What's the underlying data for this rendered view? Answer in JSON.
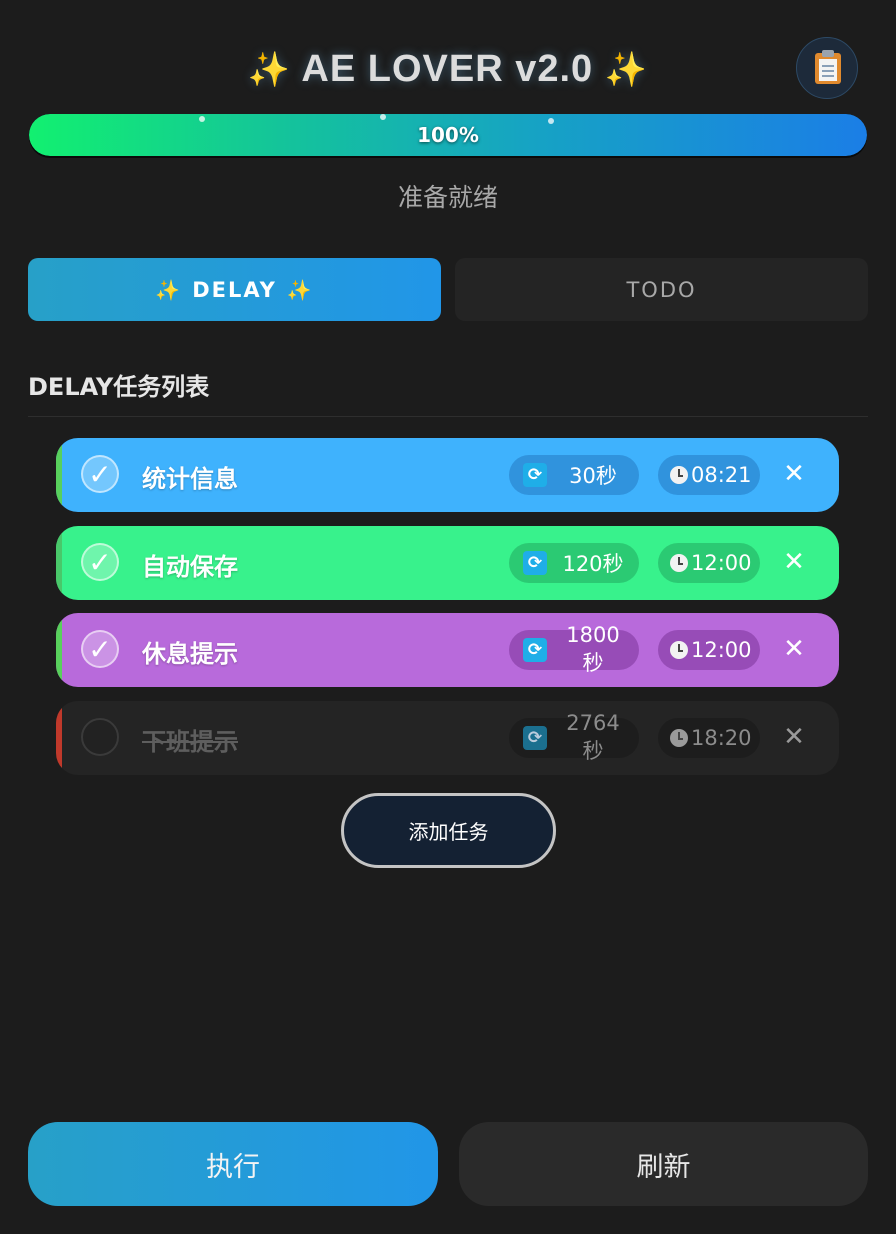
{
  "header": {
    "title": "AE LOVER v2.0",
    "sparkle": "✨",
    "clipboard_icon": "clipboard-icon"
  },
  "progress": {
    "percent": 100,
    "label": "100%",
    "status": "准备就绪"
  },
  "tabs": [
    {
      "label": "DELAY",
      "active": true
    },
    {
      "label": "TODO",
      "active": false
    }
  ],
  "section": {
    "title": "DELAY任务列表"
  },
  "tasks": [
    {
      "name": "统计信息",
      "interval": "30秒",
      "time": "08:21",
      "enabled": true,
      "color": "#3fb2fd"
    },
    {
      "name": "自动保存",
      "interval": "120秒",
      "time": "12:00",
      "enabled": true,
      "color": "#38f28c"
    },
    {
      "name": "休息提示",
      "interval": "1800秒",
      "time": "12:00",
      "enabled": true,
      "color": "#b86adb"
    },
    {
      "name": "下班提示",
      "interval": "2764秒",
      "time": "18:20",
      "enabled": false,
      "color": "#242424"
    }
  ],
  "add_button": {
    "label": "添加任务"
  },
  "footer": {
    "execute_label": "执行",
    "refresh_label": "刷新"
  },
  "colors": {
    "background": "#1c1c1c",
    "accent_blue": "#2196e8",
    "progress_start": "#12f070",
    "sparkle": "#f6c445",
    "disabled_edge": "#c0392b"
  },
  "icons": {
    "check": "✓",
    "close": "✕",
    "refresh": "⟳"
  }
}
